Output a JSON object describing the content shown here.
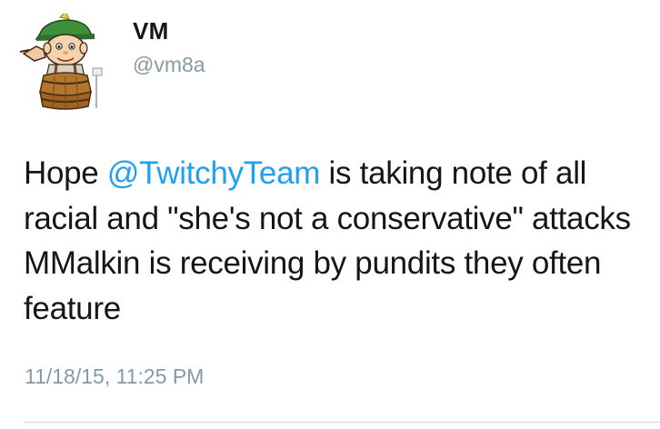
{
  "tweet": {
    "author": {
      "display_name": "VM",
      "username": "@vm8a",
      "avatar_icon": "cartoon-boy-in-barrel-icon"
    },
    "text": {
      "before": "Hope ",
      "mention": "@TwitchyTeam",
      "after": " is taking note of all racial and \"she's not a conservative\" attacks MMalkin is receiving by pundits they often feature"
    },
    "timestamp": "11/18/15, 11:25 PM"
  },
  "colors": {
    "link": "#1da1f2",
    "text": "#14171a",
    "secondary": "#8899a6"
  }
}
